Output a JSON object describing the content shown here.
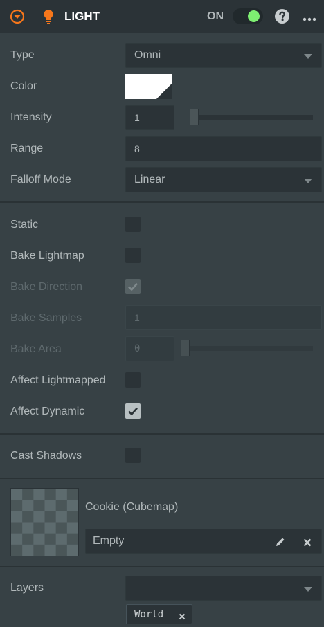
{
  "header": {
    "title": "LIGHT",
    "toggle_label": "ON",
    "help_icon": "help-icon",
    "more_icon": "more-icon",
    "collapse_icon": "collapse-icon",
    "light_icon": "light-bulb-icon",
    "accent_color": "#f7771b",
    "toggle_on_color": "#7ef072"
  },
  "fields": {
    "type": {
      "label": "Type",
      "value": "Omni"
    },
    "color": {
      "label": "Color",
      "swatch": "#ffffff"
    },
    "intensity": {
      "label": "Intensity",
      "value": "1",
      "level": 0.0
    },
    "range": {
      "label": "Range",
      "value": "8"
    },
    "falloff": {
      "label": "Falloff Mode",
      "value": "Linear"
    }
  },
  "flags": {
    "static": {
      "label": "Static",
      "checked": false
    },
    "bake_lightmap": {
      "label": "Bake Lightmap",
      "checked": false
    },
    "bake_direction": {
      "label": "Bake Direction",
      "checked": true,
      "disabled": true
    },
    "bake_samples": {
      "label": "Bake Samples",
      "value": "1",
      "disabled": true
    },
    "bake_area": {
      "label": "Bake Area",
      "value": "0",
      "level": 0.0,
      "disabled": true
    },
    "affect_lightmapped": {
      "label": "Affect Lightmapped",
      "checked": false
    },
    "affect_dynamic": {
      "label": "Affect Dynamic",
      "checked": true
    }
  },
  "shadows": {
    "label": "Cast Shadows",
    "checked": false
  },
  "cookie": {
    "label": "Cookie (Cubemap)",
    "asset": "Empty"
  },
  "layers": {
    "label": "Layers",
    "value": "",
    "tags": [
      "World"
    ]
  }
}
